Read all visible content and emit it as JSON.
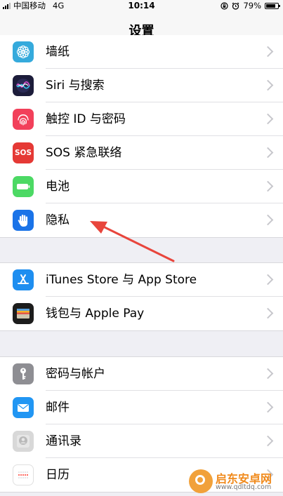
{
  "status_bar": {
    "carrier": "中国移动",
    "network": "4G",
    "time": "10:14",
    "battery_percent": "79%",
    "battery_level": 0.79
  },
  "nav": {
    "title": "设置"
  },
  "groups": [
    {
      "items": [
        {
          "label": "墙纸",
          "icon": "wallpaper-icon",
          "color": "#35aadc"
        },
        {
          "label": "Siri 与搜索",
          "icon": "siri-icon",
          "color": "#1c1c3a"
        },
        {
          "label": "触控 ID 与密码",
          "icon": "fingerprint-icon",
          "color": "#f2405a"
        },
        {
          "label": "SOS 紧急联络",
          "icon": "sos-icon",
          "color": "#e53935",
          "icon_text": "SOS"
        },
        {
          "label": "电池",
          "icon": "battery-icon",
          "color": "#4cd964"
        },
        {
          "label": "隐私",
          "icon": "hand-icon",
          "color": "#1a73e8"
        }
      ]
    },
    {
      "items": [
        {
          "label": "iTunes Store 与 App Store",
          "icon": "app-store-icon",
          "color": "#1e8ef0"
        },
        {
          "label": "钱包与 Apple Pay",
          "icon": "wallet-icon",
          "color": "#1c1c1c"
        }
      ]
    },
    {
      "items": [
        {
          "label": "密码与帐户",
          "icon": "key-icon",
          "color": "#8e8e93"
        },
        {
          "label": "邮件",
          "icon": "mail-icon",
          "color": "#2196f3"
        },
        {
          "label": "通讯录",
          "icon": "contacts-icon",
          "color": "#cfcfcf"
        },
        {
          "label": "日历",
          "icon": "calendar-icon",
          "color": "#ffffff"
        }
      ]
    }
  ],
  "watermark": {
    "title": "启东安卓网",
    "url": "www.qdltdq.com"
  },
  "colors": {
    "annotation_arrow": "#e8453c",
    "watermark": "#f08a1c"
  }
}
